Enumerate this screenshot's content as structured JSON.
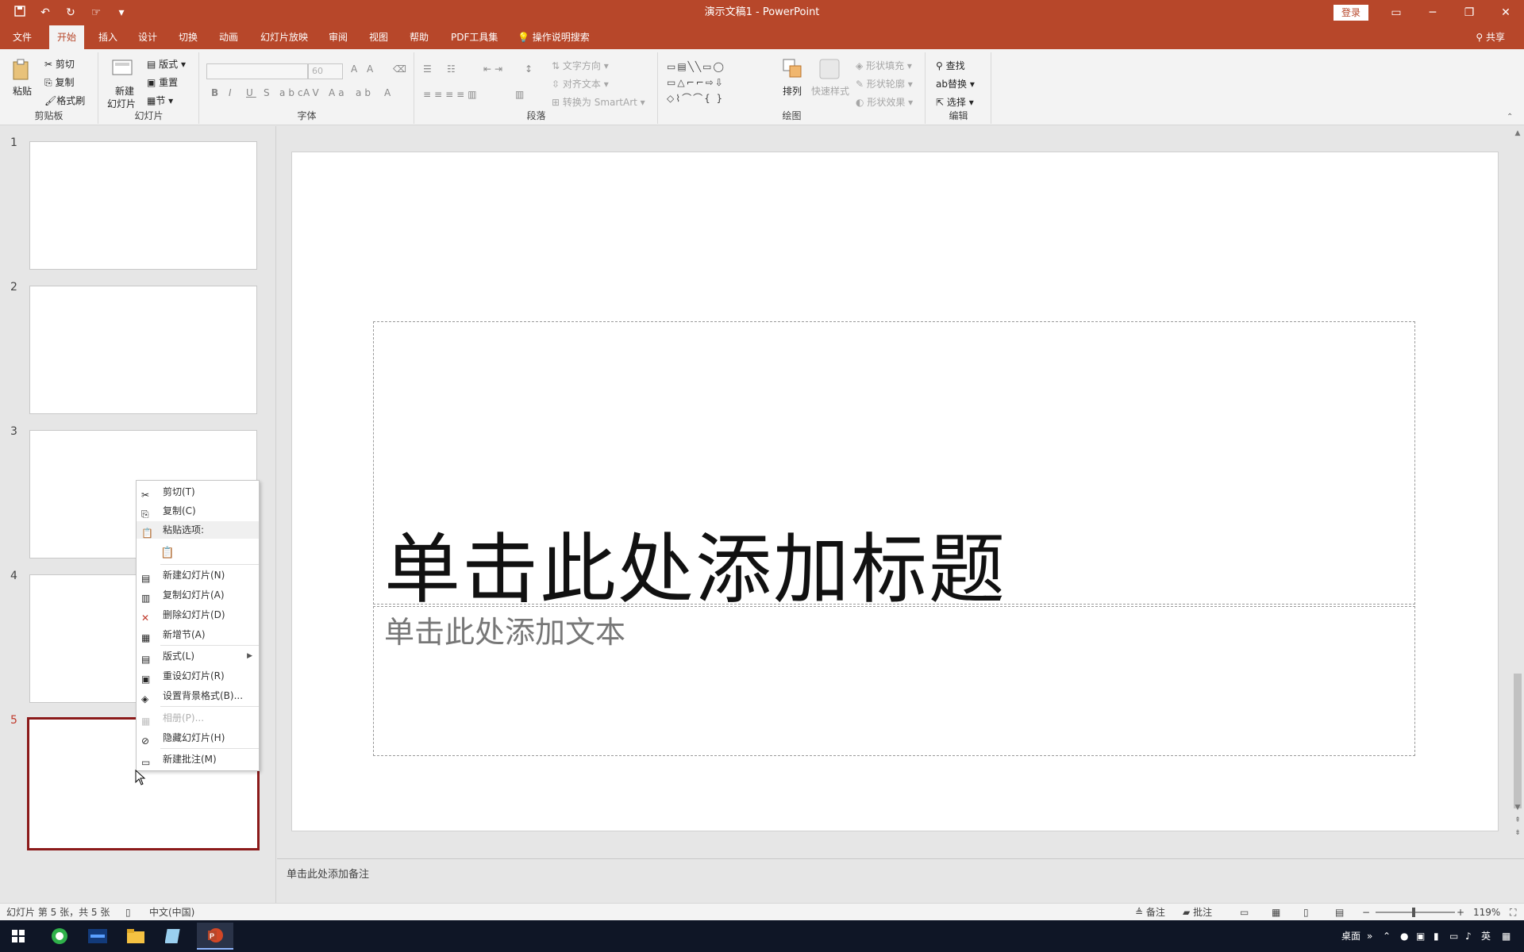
{
  "titlebar": {
    "title": "演示文稿1  -  PowerPoint",
    "signin_label": "登录",
    "qat": {
      "save_icon": "save-icon",
      "undo_icon": "undo-icon",
      "redo_icon": "redo-icon",
      "touch_icon": "touch-mode-icon",
      "customize_icon": "customize-icon"
    }
  },
  "tabs": [
    {
      "label": "文件"
    },
    {
      "label": "开始"
    },
    {
      "label": "插入"
    },
    {
      "label": "设计"
    },
    {
      "label": "切换"
    },
    {
      "label": "动画"
    },
    {
      "label": "幻灯片放映"
    },
    {
      "label": "审阅"
    },
    {
      "label": "视图"
    },
    {
      "label": "帮助"
    },
    {
      "label": "PDF工具集"
    }
  ],
  "tellme": "操作说明搜索",
  "share": "共享",
  "ribbon": {
    "clipboard": {
      "label": "剪贴板",
      "paste": "粘贴",
      "cut": "剪切",
      "copy": "复制",
      "format_painter": "格式刷"
    },
    "slides": {
      "label": "幻灯片",
      "new_slide_line1": "新建",
      "new_slide_line2": "幻灯片",
      "layout": "版式",
      "reset": "重置",
      "section": "节"
    },
    "font": {
      "label": "字体",
      "font_size": "60"
    },
    "paragraph": {
      "label": "段落",
      "text_direction": "文字方向",
      "align_text": "对齐文本",
      "convert_smartart": "转换为 SmartArt"
    },
    "drawing": {
      "label": "绘图",
      "arrange": "排列",
      "quick_styles": "快速样式",
      "shape_fill": "形状填充",
      "shape_outline": "形状轮廓",
      "shape_effects": "形状效果"
    },
    "editing": {
      "label": "编辑",
      "find": "查找",
      "replace": "替换",
      "select": "选择"
    }
  },
  "thumbnails": [
    {
      "num": "1"
    },
    {
      "num": "2"
    },
    {
      "num": "3"
    },
    {
      "num": "4"
    },
    {
      "num": "5"
    }
  ],
  "slide": {
    "title_placeholder": "单击此处添加标题",
    "body_placeholder": "单击此处添加文本"
  },
  "notes_placeholder": "单击此处添加备注",
  "context_menu": {
    "cut": "剪切(T)",
    "copy": "复制(C)",
    "paste_options": "粘贴选项:",
    "new_slide": "新建幻灯片(N)",
    "duplicate_slide": "复制幻灯片(A)",
    "delete_slide": "删除幻灯片(D)",
    "add_section": "新增节(A)",
    "layout": "版式(L)",
    "reset_slide": "重设幻灯片(R)",
    "format_background": "设置背景格式(B)...",
    "photo_album": "相册(P)...",
    "hide_slide": "隐藏幻灯片(H)",
    "new_comment": "新建批注(M)"
  },
  "statusbar": {
    "slide_info": "幻灯片 第 5 张，共 5 张",
    "language": "中文(中国)",
    "notes": "备注",
    "comments": "批注",
    "zoom": "119%"
  },
  "taskbar": {
    "desktop": "桌面",
    "ime": "英"
  },
  "colors": {
    "accent": "#b7472a",
    "selected_thumb_border": "#8b1a1a"
  }
}
